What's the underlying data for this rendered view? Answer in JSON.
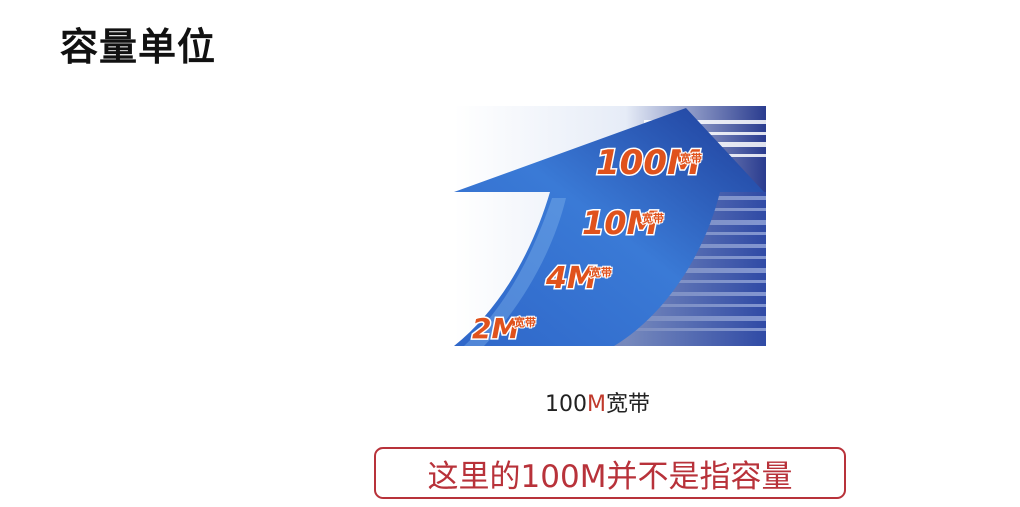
{
  "slide": {
    "title": "容量单位",
    "figure": {
      "labels": [
        {
          "main": "100M",
          "sub": "宽带"
        },
        {
          "main": "10M",
          "sub": "宽带"
        },
        {
          "main": "4M",
          "sub": "宽带"
        },
        {
          "main": "2M",
          "sub": "宽带"
        }
      ]
    },
    "caption": {
      "prefix": "100",
      "accent": "M",
      "suffix": "宽带"
    },
    "note": "这里的100M并不是指容量"
  },
  "colors": {
    "arrow_dark": "#1f3f9a",
    "arrow_light": "#6aa7e6",
    "label_orange": "#e0521c",
    "note_red": "#b8323a",
    "caption_accent": "#c0392b"
  },
  "icons": [
    "upward-arrow-graphic"
  ]
}
